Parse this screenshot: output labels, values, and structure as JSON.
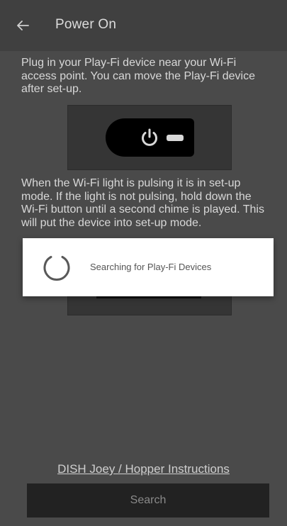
{
  "header": {
    "back_icon": "arrow-left-icon",
    "title": "Power On"
  },
  "content": {
    "instruction_1": "Plug in your Play-Fi device near your Wi-Fi access point. You can move the Play-Fi device after set-up.",
    "instruction_2": "When the Wi-Fi light is pulsing it is in set-up mode. If the light is not pulsing, hold down the Wi-Fi button until a second chime is played. This will put the device into set-up mode."
  },
  "dialog": {
    "spinner_icon": "loading-spinner-icon",
    "message": "Searching for Play-Fi Devices"
  },
  "footer": {
    "link_label": "DISH Joey / Hopper Instructions",
    "search_label": "Search"
  },
  "colors": {
    "background": "#4a4a4a",
    "appbar": "#404040",
    "button": "#222222",
    "dialog": "#ffffff"
  }
}
